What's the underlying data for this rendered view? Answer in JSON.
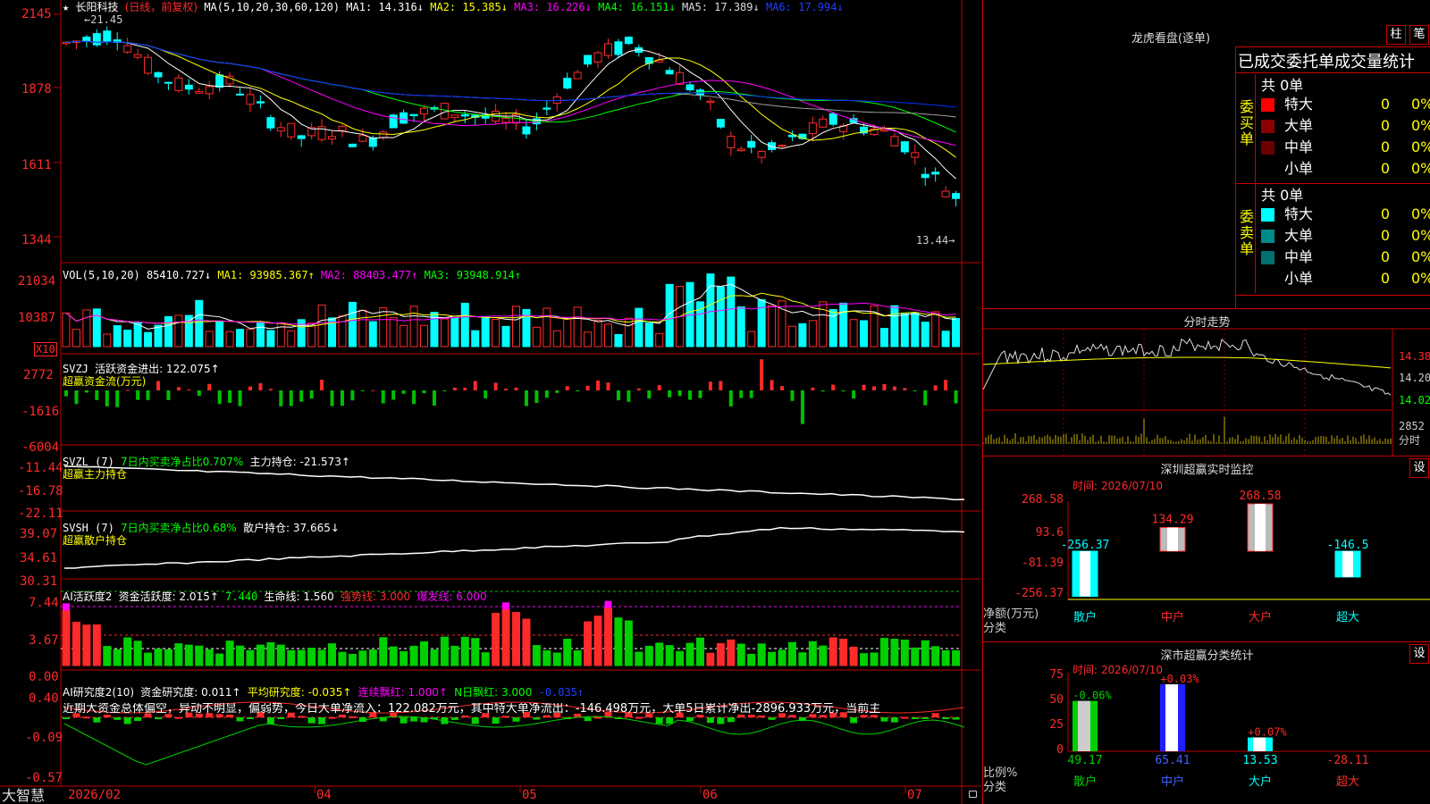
{
  "colors": {
    "up": "#ff2a2a",
    "down": "#00ffff",
    "grid": "#a00000",
    "frame": "#c00000",
    "ma1": "#ffffff",
    "ma2": "#ffff00",
    "ma3": "#ff00ff",
    "ma4": "#00ff00",
    "ma5": "#a0a0a0",
    "ma6": "#0030ff",
    "green": "#00e000",
    "yellow": "#ffff00"
  },
  "main": {
    "header": {
      "star": "★",
      "stock": "长阳科技",
      "period": "(日线，前复权)",
      "ma_def": "MA(5,10,20,30,60,120)",
      "ma1": "MA1: 14.316↓",
      "ma2": "MA2: 15.385↓",
      "ma3": "MA3: 16.226↓",
      "ma4": "MA4: 16.151↓",
      "ma5": "MA5: 17.389↓",
      "ma6": "MA6: 17.994↓"
    },
    "high_note": "←21.45",
    "low_note": "13.44→",
    "yticks": [
      "2145",
      "1878",
      "1611",
      "1344"
    ]
  },
  "vol": {
    "title": "VOL(5,10,20)",
    "value": "85410.727↓",
    "ma1": "MA1: 93985.367↑",
    "ma2": "MA2: 88403.477↑",
    "ma3": "MA3: 93948.914↑",
    "yticks": [
      "21034",
      "10387"
    ],
    "unit": "X10"
  },
  "svzj": {
    "title": "SVZJ",
    "label": "活跃资金进出: 122.075↑",
    "sub": "超赢资金流(万元)",
    "yticks": [
      "2772",
      "-1616",
      "-6004"
    ]
  },
  "svzl": {
    "title": "SVZL (7)",
    "ratio": "7日内买卖净占比0.707%",
    "label": "主力持仓: -21.573↑",
    "sub": "超赢主力持仓",
    "yticks": [
      "-11.44",
      "-16.78",
      "-22.11"
    ]
  },
  "svsh": {
    "title": "SVSH (7)",
    "ratio": "7日内买卖净占比0.68%",
    "label": "散户持仓: 37.665↓",
    "sub": "超赢散户持仓",
    "yticks": [
      "39.07",
      "34.61",
      "30.31"
    ]
  },
  "ai2": {
    "title": "AI活跃度2",
    "a": "资金活跃度: 2.015↑",
    "b": "7.440",
    "c": "生命线: 1.560",
    "d": "强势线: 3.000",
    "e": "爆发线: 6.000",
    "yticks": [
      "7.44",
      "3.67",
      "0.00"
    ]
  },
  "ai_study": {
    "title": "AI研究度2(10)",
    "a": "资金研究度: 0.011↑",
    "b": "平均研究度: -0.035↑",
    "c": "连续飘红: 1.000↑",
    "d": "N日飘红: 3.000",
    "e": "-0.035↑",
    "desc": "近期大资金总体偏空，异动不明显，偏弱势，今日大单净流入：122.082万元，其中特大单净流出：-146.498万元，大单5日累计净出-2896.933万元，当前主",
    "yticks": [
      "0.40",
      "-0.09",
      "-0.57"
    ]
  },
  "xaxis": {
    "brand": "大智慧",
    "labels": [
      "2026/02",
      "04",
      "05",
      "06",
      "07"
    ]
  },
  "lhb": {
    "title": "龙虎看盘(逐单)",
    "btn1": "柱",
    "btn2": "笔",
    "subtitle": "已成交委托单成交量统计",
    "buy_label": "委买单",
    "sell_label": "委卖单",
    "buy_total": "共 0单",
    "sell_total": "共 0单",
    "buy_rows": [
      {
        "name": "特大",
        "v": "0",
        "p": "0%",
        "c": "#ff0000"
      },
      {
        "name": "大单",
        "v": "0",
        "p": "0%",
        "c": "#8b0000"
      },
      {
        "name": "中单",
        "v": "0",
        "p": "0%",
        "c": "#6b0000"
      },
      {
        "name": "小单",
        "v": "0",
        "p": "0%",
        "c": "#000000"
      }
    ],
    "sell_rows": [
      {
        "name": "特大",
        "v": "0",
        "p": "0%",
        "c": "#00ffff"
      },
      {
        "name": "大单",
        "v": "0",
        "p": "0%",
        "c": "#008b8b"
      },
      {
        "name": "中单",
        "v": "0",
        "p": "0%",
        "c": "#007070"
      },
      {
        "name": "小单",
        "v": "0",
        "p": "0%",
        "c": "#000000"
      }
    ]
  },
  "intraday": {
    "title": "分时走势",
    "yticks": [
      "14.38",
      "14.20",
      "14.02"
    ],
    "vol_label": "2852",
    "vol_unit": "分时"
  },
  "sz_monitor": {
    "title": "深圳超赢实时监控",
    "btn": "设",
    "time": "时间: 2026/07/10",
    "yticks": [
      "268.58",
      "93.6",
      "-81.39",
      "-256.37"
    ],
    "unit1": "净额(万元)",
    "unit2": "分类",
    "bars": [
      {
        "name": "散户",
        "value": -256.37,
        "label": "-256.37"
      },
      {
        "name": "中户",
        "value": 134.29,
        "label": "134.29"
      },
      {
        "name": "大户",
        "value": 268.58,
        "label": "268.58"
      },
      {
        "name": "超大",
        "value": -146.5,
        "label": "-146.5"
      }
    ]
  },
  "sz_class": {
    "title": "深市超赢分类统计",
    "btn": "设",
    "time": "时间: 2026/07/10",
    "yticks": [
      "75",
      "50",
      "25",
      "0"
    ],
    "unit1": "比例%",
    "unit2": "分类",
    "bars": [
      {
        "name": "散户",
        "value": 49.17,
        "label": "49.17",
        "change": "-0.06%"
      },
      {
        "name": "中户",
        "value": 65.41,
        "label": "65.41",
        "change": "+0.03%"
      },
      {
        "name": "大户",
        "value": 13.53,
        "label": "13.53",
        "change": "+0.07%"
      },
      {
        "name": "超大",
        "value": -28.11,
        "label": "-28.11",
        "change": ""
      }
    ]
  }
}
